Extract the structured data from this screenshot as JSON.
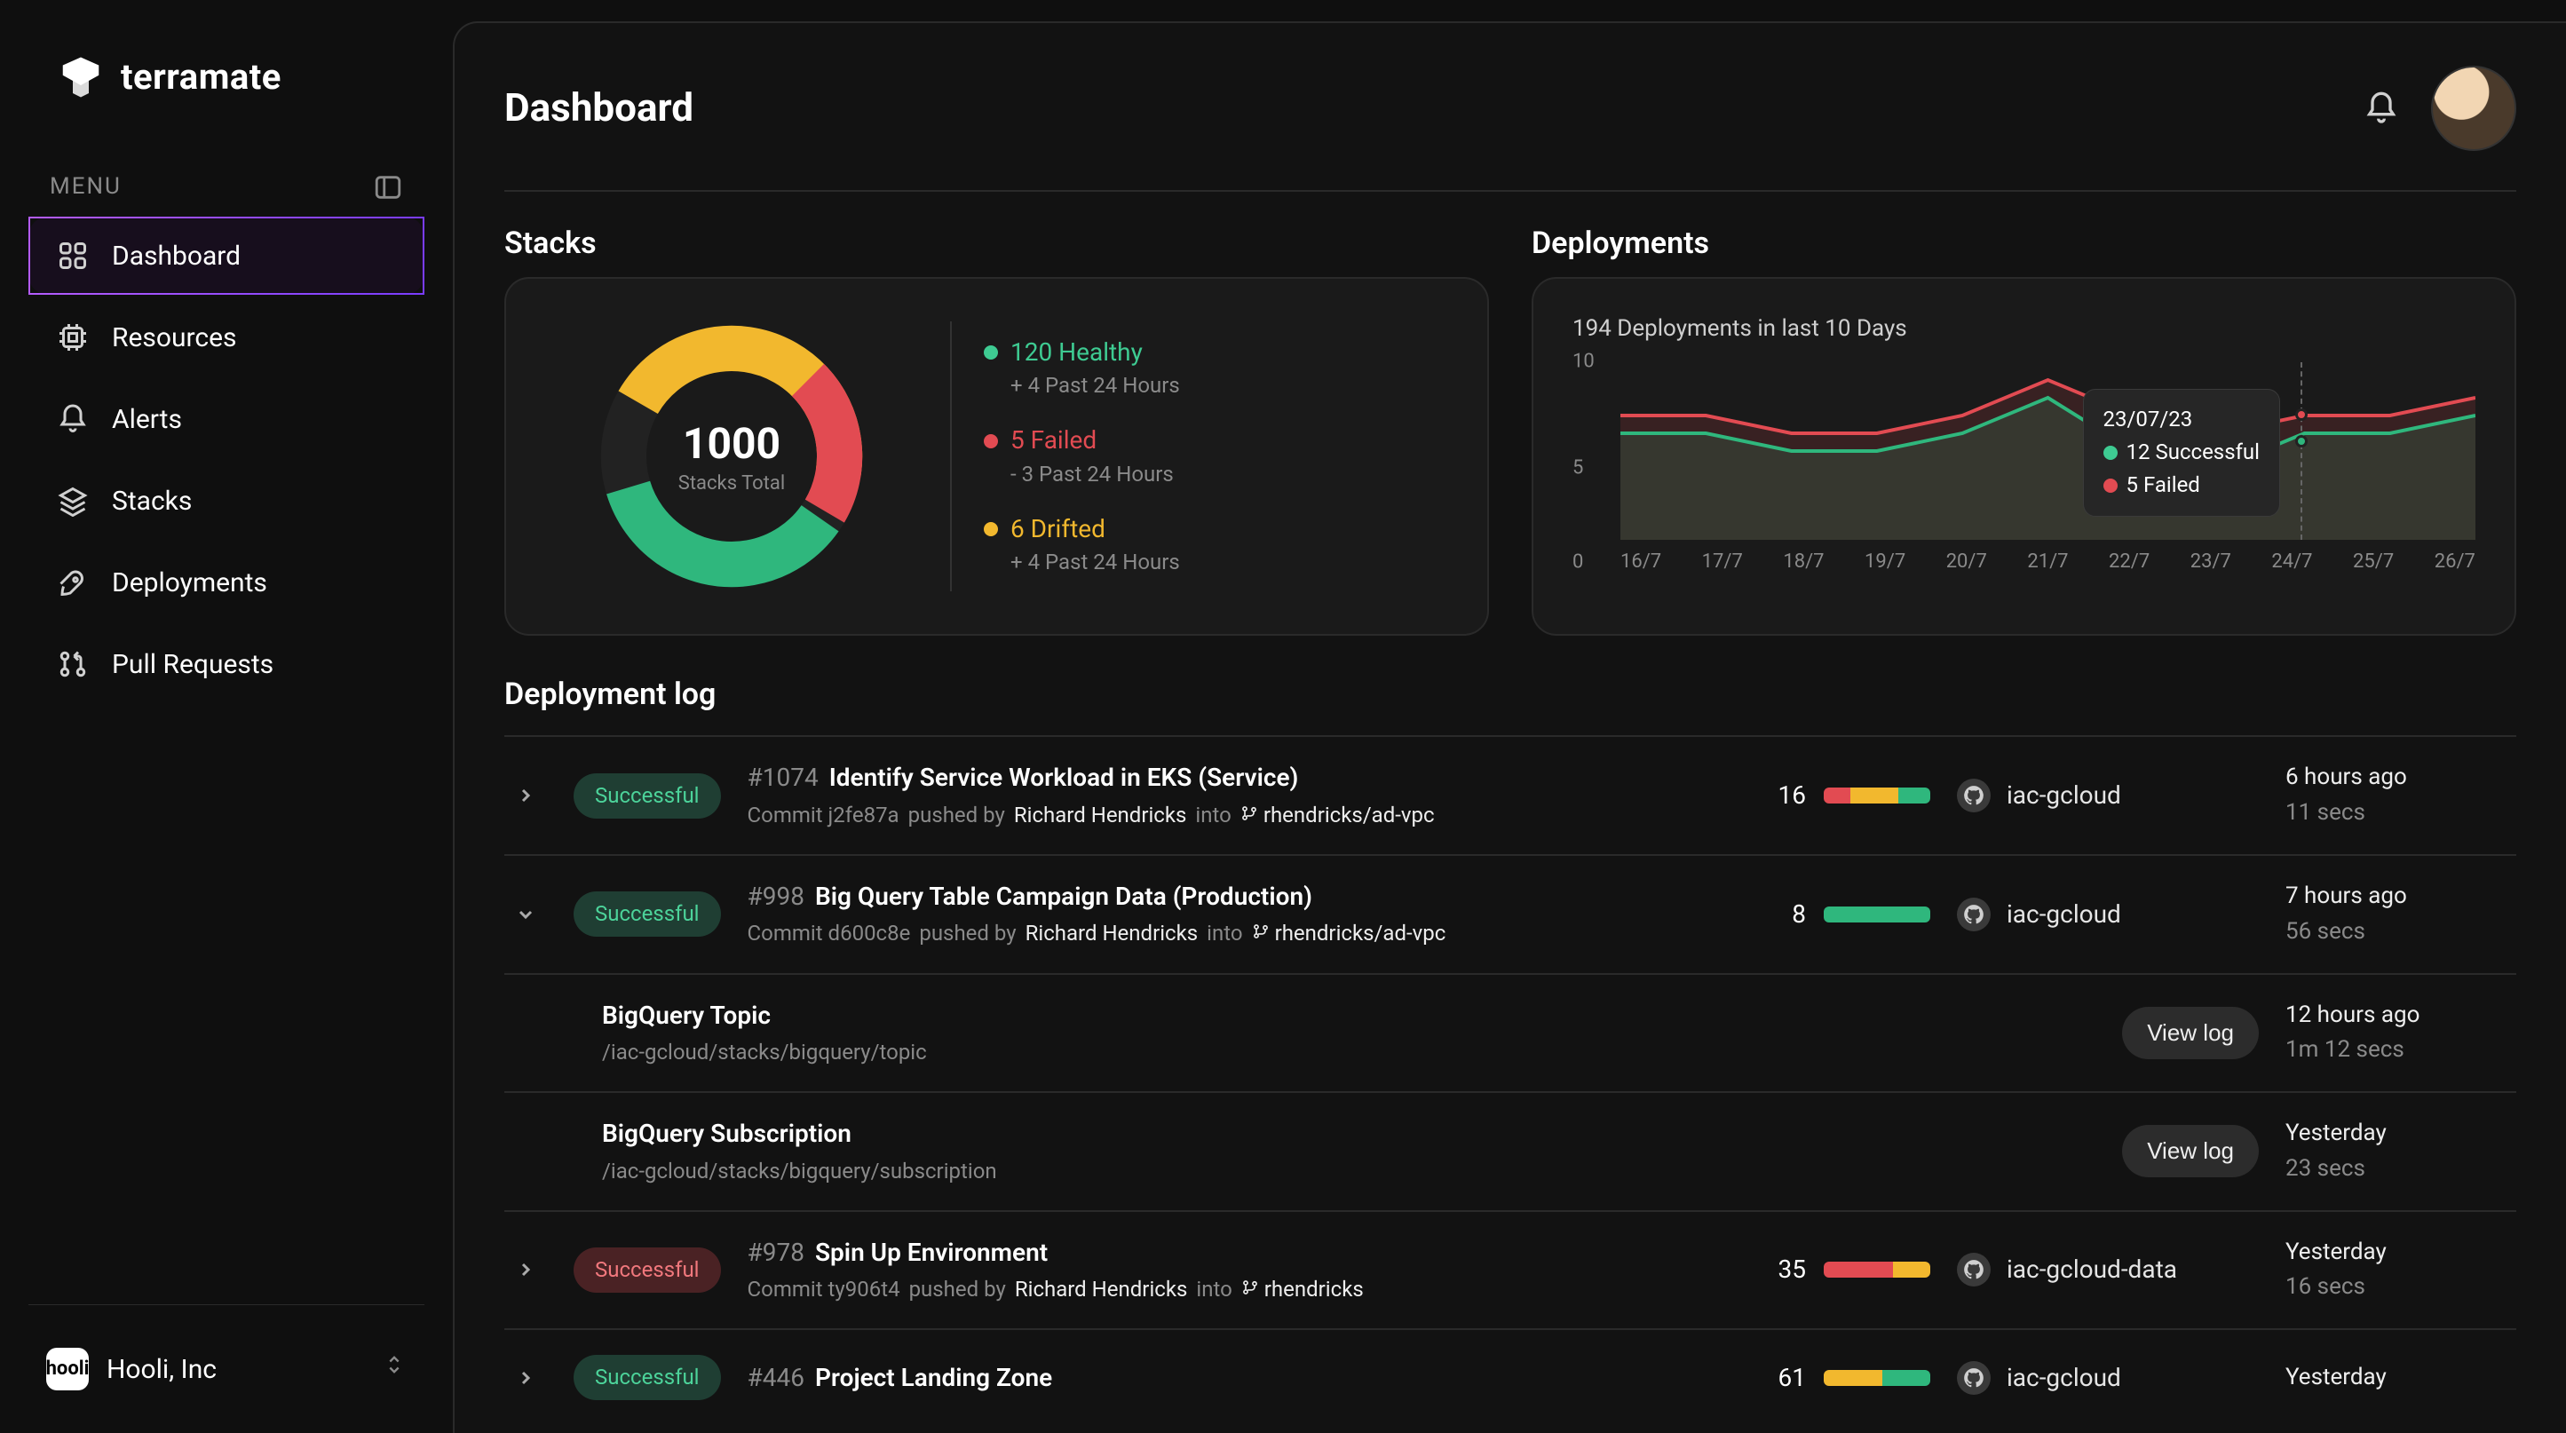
{
  "brand": {
    "name": "terramate"
  },
  "sidebar": {
    "menu_label": "MENU",
    "items": [
      {
        "label": "Dashboard",
        "icon": "grid-icon",
        "active": true
      },
      {
        "label": "Resources",
        "icon": "cpu-icon",
        "active": false
      },
      {
        "label": "Alerts",
        "icon": "bell-icon",
        "active": false
      },
      {
        "label": "Stacks",
        "icon": "layers-icon",
        "active": false
      },
      {
        "label": "Deployments",
        "icon": "rocket-icon",
        "active": false
      },
      {
        "label": "Pull Requests",
        "icon": "pull-request-icon",
        "active": false
      }
    ],
    "org": {
      "name": "Hooli, Inc",
      "shortname": "hooli"
    }
  },
  "header": {
    "title": "Dashboard"
  },
  "sections": {
    "stacks_title": "Stacks",
    "deployments_title": "Deployments",
    "deployment_log_title": "Deployment log"
  },
  "stacks_card": {
    "total_value": "1000",
    "total_label": "Stacks Total",
    "legend": [
      {
        "color": "green",
        "label": "120 Healthy",
        "sub": "+ 4 Past 24 Hours"
      },
      {
        "color": "red",
        "label": "5 Failed",
        "sub": "- 3 Past 24 Hours"
      },
      {
        "color": "yellow",
        "label": "6 Drifted",
        "sub": "+ 4 Past 24 Hours"
      }
    ]
  },
  "deployments_card": {
    "subtitle": "194 Deployments in last 10 Days",
    "tooltip": {
      "date": "23/07/23",
      "rows": [
        {
          "color": "green",
          "text": "12 Successful"
        },
        {
          "color": "red",
          "text": "5 Failed"
        }
      ]
    }
  },
  "chart_data": {
    "type": "line",
    "x": [
      "16/7",
      "17/7",
      "18/7",
      "19/7",
      "20/7",
      "21/7",
      "22/7",
      "23/7",
      "24/7",
      "25/7",
      "26/7"
    ],
    "series": [
      {
        "name": "Failed",
        "color": "#e24b52",
        "values": [
          7,
          7,
          6,
          6,
          7,
          9,
          7,
          6,
          7,
          7,
          8
        ]
      },
      {
        "name": "Successful",
        "color": "#2fb77d",
        "values": [
          6,
          6,
          5,
          5,
          6,
          8,
          5,
          4,
          6,
          6,
          7
        ]
      }
    ],
    "yTicks": [
      0,
      5,
      10
    ],
    "ylim": [
      0,
      10
    ],
    "highlight_x": "23/7"
  },
  "log": [
    {
      "type": "row",
      "caret": "right",
      "pill": "ok",
      "pill_label": "Successful",
      "id": "#1074",
      "title": "Identify Service Workload in EKS (Service)",
      "commit": "Commit j2fe87a",
      "pushed_by": "pushed by",
      "person": "Richard Hendricks",
      "into": "into",
      "branch": "rhendricks/ad-vpc",
      "count": 16,
      "bar": [
        [
          "#e24b52",
          25
        ],
        [
          "#f2b82e",
          45
        ],
        [
          "#2fb77d",
          30
        ]
      ],
      "repo": "iac-gcloud",
      "ago": "6 hours ago",
      "dur": "11 secs"
    },
    {
      "type": "row",
      "caret": "down",
      "pill": "ok",
      "pill_label": "Successful",
      "id": "#998",
      "title": "Big Query Table Campaign Data (Production)",
      "commit": "Commit d600c8e",
      "pushed_by": "pushed by",
      "person": "Richard Hendricks",
      "into": "into",
      "branch": "rhendricks/ad-vpc",
      "count": 8,
      "bar": [
        [
          "#2fb77d",
          100
        ]
      ],
      "repo": "iac-gcloud",
      "ago": "7 hours ago",
      "dur": "56 secs"
    },
    {
      "type": "sub",
      "subtitle": "BigQuery Topic",
      "subpath": "/iac-gcloud/stacks/bigquery/topic",
      "view_log": "View log",
      "ago": "12 hours ago",
      "dur": "1m 12 secs"
    },
    {
      "type": "sub",
      "subtitle": "BigQuery Subscription",
      "subpath": "/iac-gcloud/stacks/bigquery/subscription",
      "view_log": "View log",
      "ago": "Yesterday",
      "dur": "23 secs"
    },
    {
      "type": "row",
      "caret": "right",
      "pill": "bad",
      "pill_label": "Successful",
      "id": "#978",
      "title": "Spin Up Environment",
      "commit": "Commit ty906t4",
      "pushed_by": "pushed by",
      "person": "Richard Hendricks",
      "into": "into",
      "branch": "rhendricks",
      "count": 35,
      "bar": [
        [
          "#e24b52",
          65
        ],
        [
          "#f2b82e",
          35
        ]
      ],
      "repo": "iac-gcloud-data",
      "ago": "Yesterday",
      "dur": "16 secs"
    },
    {
      "type": "row",
      "caret": "right",
      "pill": "ok",
      "pill_label": "Successful",
      "id": "#446",
      "title": "Project Landing Zone",
      "commit": "",
      "pushed_by": "",
      "person": "",
      "into": "",
      "branch": "",
      "count": 61,
      "bar": [
        [
          "#f2b82e",
          55
        ],
        [
          "#2fb77d",
          45
        ]
      ],
      "repo": "iac-gcloud",
      "ago": "Yesterday",
      "dur": ""
    }
  ]
}
